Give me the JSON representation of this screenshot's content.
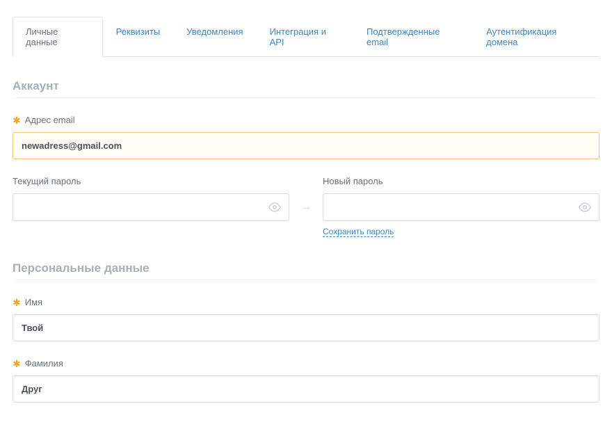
{
  "tabs": [
    {
      "label": "Личные данные",
      "active": true
    },
    {
      "label": "Реквизиты",
      "active": false
    },
    {
      "label": "Уведомления",
      "active": false
    },
    {
      "label": "Интеграция и API",
      "active": false
    },
    {
      "label": "Подтвержденные email",
      "active": false
    },
    {
      "label": "Аутентификация домена",
      "active": false
    }
  ],
  "account": {
    "title": "Аккаунт",
    "email_label": "Адрес email",
    "email_value": "newadress@gmail.com",
    "current_password_label": "Текущий пароль",
    "new_password_label": "Новый пароль",
    "save_password_label": "Сохранить пароль"
  },
  "personal": {
    "title": "Персональные данные",
    "firstname_label": "Имя",
    "firstname_value": "Твой",
    "lastname_label": "Фамилия",
    "lastname_value": "Друг"
  }
}
